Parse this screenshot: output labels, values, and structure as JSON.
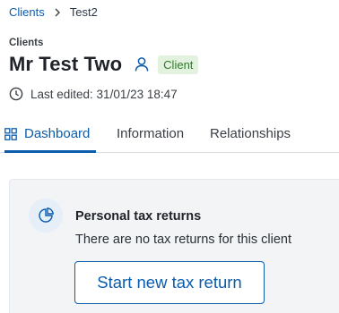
{
  "breadcrumb": {
    "parent": "Clients",
    "current": "Test2"
  },
  "header": {
    "section_label": "Clients",
    "title": "Mr Test Two",
    "badge": "Client",
    "last_edited": "Last edited: 31/01/23 18:47"
  },
  "tabs": [
    {
      "label": "Dashboard",
      "active": true
    },
    {
      "label": "Information",
      "active": false
    },
    {
      "label": "Relationships",
      "active": false
    }
  ],
  "card": {
    "title": "Personal tax returns",
    "text": "There are no tax returns for this client",
    "button_label": "Start new tax return"
  },
  "icons": {
    "chevron": "chevron-right-icon",
    "person": "person-icon",
    "clock": "clock-icon",
    "dashboard": "dashboard-grid-icon",
    "chart": "pie-chart-icon"
  },
  "colors": {
    "accent": "#0b5cad",
    "badge_bg": "#e3f2df",
    "badge_text": "#2f7a2a",
    "panel_bg": "#f2f4f6"
  }
}
